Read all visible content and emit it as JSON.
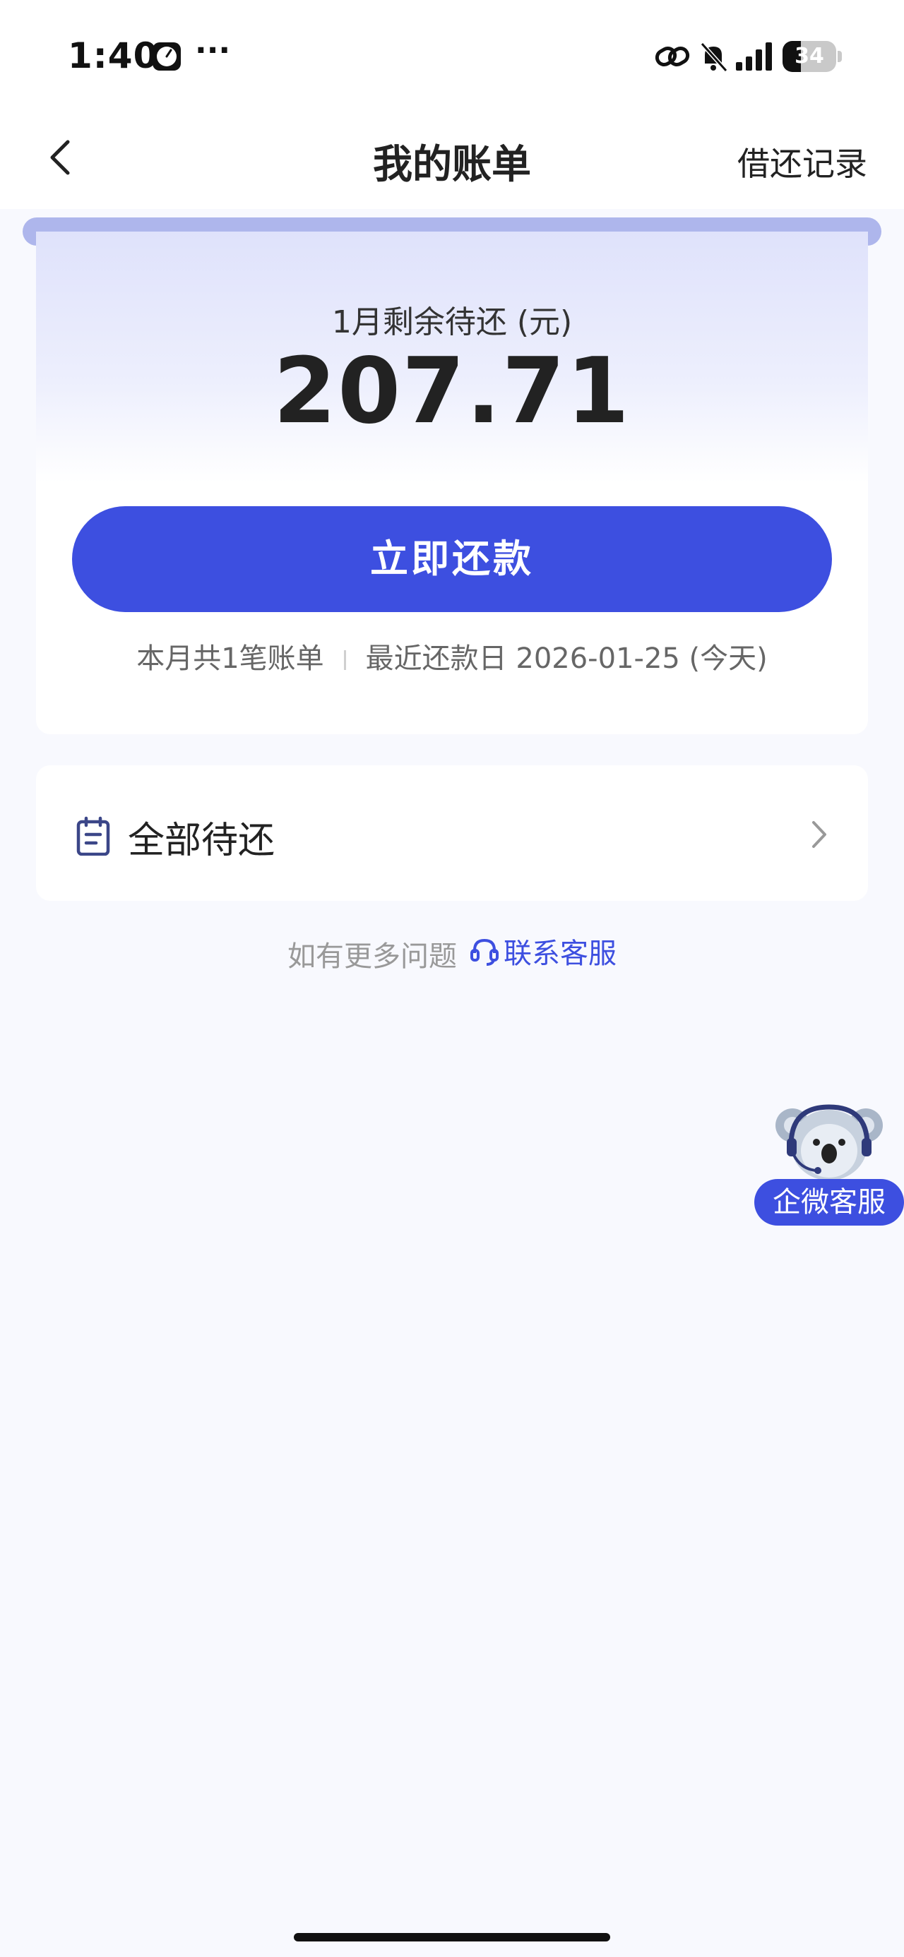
{
  "status_bar": {
    "time": "1:40",
    "more": "···",
    "battery": "34",
    "battery_level": 0.34
  },
  "nav": {
    "title": "我的账单",
    "action": "借还记录"
  },
  "bill": {
    "label": "1月剩余待还 (元)",
    "amount": "207.71",
    "button": "立即还款",
    "count_text": "本月共1笔账单",
    "due_text": "最近还款日 2026-01-25 (今天)"
  },
  "pending": {
    "label": "全部待还"
  },
  "help": {
    "text": "如有更多问题",
    "link": "联系客服"
  },
  "floating": {
    "label": "企微客服"
  },
  "colors": {
    "accent": "#3d4fe0",
    "page_bg": "#f8f9fe",
    "card_header": "#aeb6ec"
  },
  "icons": [
    "back-arrow-icon",
    "clock-icon",
    "link-icon",
    "mute-icon",
    "signal-icon",
    "battery-icon",
    "clipboard-icon",
    "chevron-right-icon",
    "headset-icon",
    "koala-mascot-icon"
  ]
}
